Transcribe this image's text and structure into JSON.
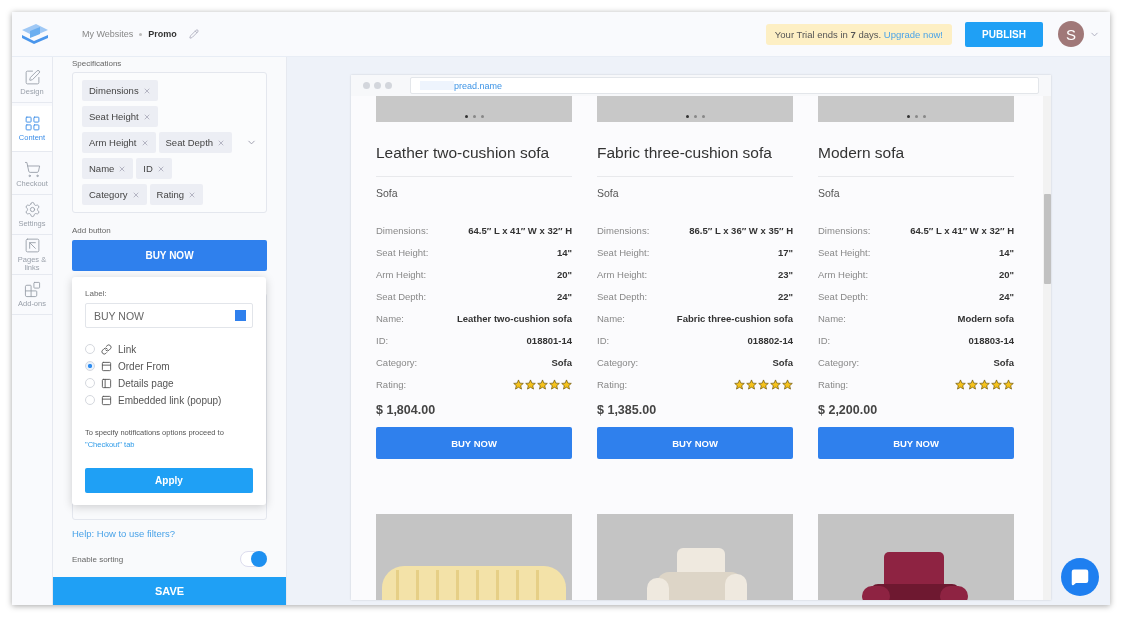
{
  "header": {
    "breadcrumb": [
      "My Websites",
      "Promo"
    ],
    "trial": "Your Trial ends in **7** days.",
    "trial_link": "Upgrade now!",
    "publish": "PUBLISH",
    "avatar": "S"
  },
  "rail": [
    {
      "label": "Design",
      "selected": false
    },
    {
      "label": "Content",
      "selected": true
    },
    {
      "label": "Checkout",
      "selected": false
    },
    {
      "label": "Settings",
      "selected": false
    },
    {
      "label": "Pages & links",
      "selected": false
    },
    {
      "label": "Add-ons",
      "selected": false
    }
  ],
  "panel": {
    "specifications": {
      "label": "Specifications",
      "tag_rows": [
        [
          "Dimensions"
        ],
        [
          "Seat Height"
        ],
        [
          "Arm Height",
          "Seat Depth"
        ],
        [
          "Name",
          "ID"
        ],
        [
          "Category",
          "Rating"
        ]
      ]
    },
    "add_button": {
      "label": "Add button",
      "button": "BUY NOW"
    },
    "popup": {
      "label": "Label:",
      "value": "BUY NOW",
      "color": "#2f80ed",
      "options": [
        {
          "label": "Link",
          "selected": false
        },
        {
          "label": "Order From",
          "selected": true
        },
        {
          "label": "Details page",
          "selected": false
        },
        {
          "label": "Embedded link (popup)",
          "selected": false
        }
      ],
      "note": "To specify notifications options proceed to",
      "note_link": "\"Checkout\" tab",
      "apply": "Apply"
    },
    "help_link": "Help: How to use filters?",
    "sorting": {
      "label": "Enable sorting",
      "on": true
    },
    "save": "SAVE"
  },
  "preview": {
    "url": "pread.name",
    "products": [
      {
        "title": "Leather two-cushion sofa",
        "category": "Sofa",
        "specs": [
          {
            "label": "Dimensions:",
            "value": "64.5″ L x 41″ W x 32″ H"
          },
          {
            "label": "Seat Height:",
            "value": "14\""
          },
          {
            "label": "Arm Height:",
            "value": "20\""
          },
          {
            "label": "Seat Depth:",
            "value": "24\""
          },
          {
            "label": "Name:",
            "value": "Leather two-cushion sofa"
          },
          {
            "label": "ID:",
            "value": "018801-14"
          },
          {
            "label": "Category:",
            "value": "Sofa"
          }
        ],
        "rating": {
          "label": "Rating:",
          "stars": 5
        },
        "price": "$ 1,804.00",
        "button": "BUY NOW"
      },
      {
        "title": "Fabric three-cushion sofa",
        "category": "Sofa",
        "specs": [
          {
            "label": "Dimensions:",
            "value": "86.5″ L x 36″ W x 35″ H"
          },
          {
            "label": "Seat Height:",
            "value": "17\""
          },
          {
            "label": "Arm Height:",
            "value": "23\""
          },
          {
            "label": "Seat Depth:",
            "value": "22\""
          },
          {
            "label": "Name:",
            "value": "Fabric three-cushion sofa"
          },
          {
            "label": "ID:",
            "value": "018802-14"
          },
          {
            "label": "Category:",
            "value": "Sofa"
          }
        ],
        "rating": {
          "label": "Rating:",
          "stars": 5
        },
        "price": "$ 1,385.00",
        "button": "BUY NOW"
      },
      {
        "title": "Modern sofa",
        "category": "Sofa",
        "specs": [
          {
            "label": "Dimensions:",
            "value": "64.5″ L x 41″ W x 32″ H"
          },
          {
            "label": "Seat Height:",
            "value": "14\""
          },
          {
            "label": "Arm Height:",
            "value": "20\""
          },
          {
            "label": "Seat Depth:",
            "value": "24\""
          },
          {
            "label": "Name:",
            "value": "Modern sofa"
          },
          {
            "label": "ID:",
            "value": "018803-14"
          },
          {
            "label": "Category:",
            "value": "Sofa"
          }
        ],
        "rating": {
          "label": "Rating:",
          "stars": 5
        },
        "price": "$ 2,200.00",
        "button": "BUY NOW"
      }
    ]
  }
}
